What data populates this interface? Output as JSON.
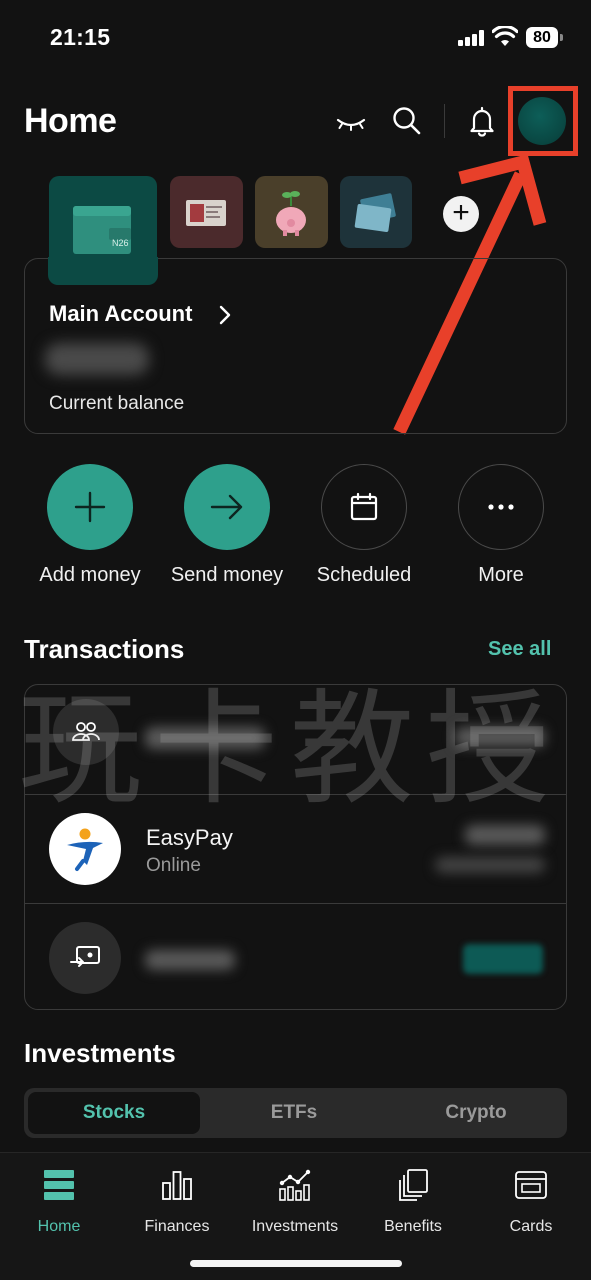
{
  "status_bar": {
    "time": "21:15",
    "battery": "80"
  },
  "header": {
    "title": "Home"
  },
  "main_account": {
    "name": "Main Account",
    "balance_label": "Current balance",
    "tile_brand": "N26"
  },
  "quick_actions": [
    {
      "label": "Add money"
    },
    {
      "label": "Send money"
    },
    {
      "label": "Scheduled"
    },
    {
      "label": "More"
    }
  ],
  "transactions": {
    "title": "Transactions",
    "see_all": "See all",
    "items": [
      {
        "icon": "group-icon"
      },
      {
        "icon": "easypay-logo",
        "name": "EasyPay",
        "subtitle": "Online"
      },
      {
        "icon": "transfer-icon"
      }
    ]
  },
  "investments": {
    "title": "Investments",
    "tabs": [
      "Stocks",
      "ETFs",
      "Crypto"
    ],
    "active_tab": "Stocks"
  },
  "tab_bar": [
    {
      "label": "Home",
      "icon": "home-icon",
      "active": true
    },
    {
      "label": "Finances",
      "icon": "bar-chart-icon"
    },
    {
      "label": "Investments",
      "icon": "line-chart-icon"
    },
    {
      "label": "Benefits",
      "icon": "stack-icon"
    },
    {
      "label": "Cards",
      "icon": "card-icon"
    }
  ],
  "watermark": "玩卡教授",
  "colors": {
    "accent": "#53c2ad",
    "button_teal": "#2ea08c",
    "highlight_red": "#e8402a",
    "background": "#121212"
  }
}
